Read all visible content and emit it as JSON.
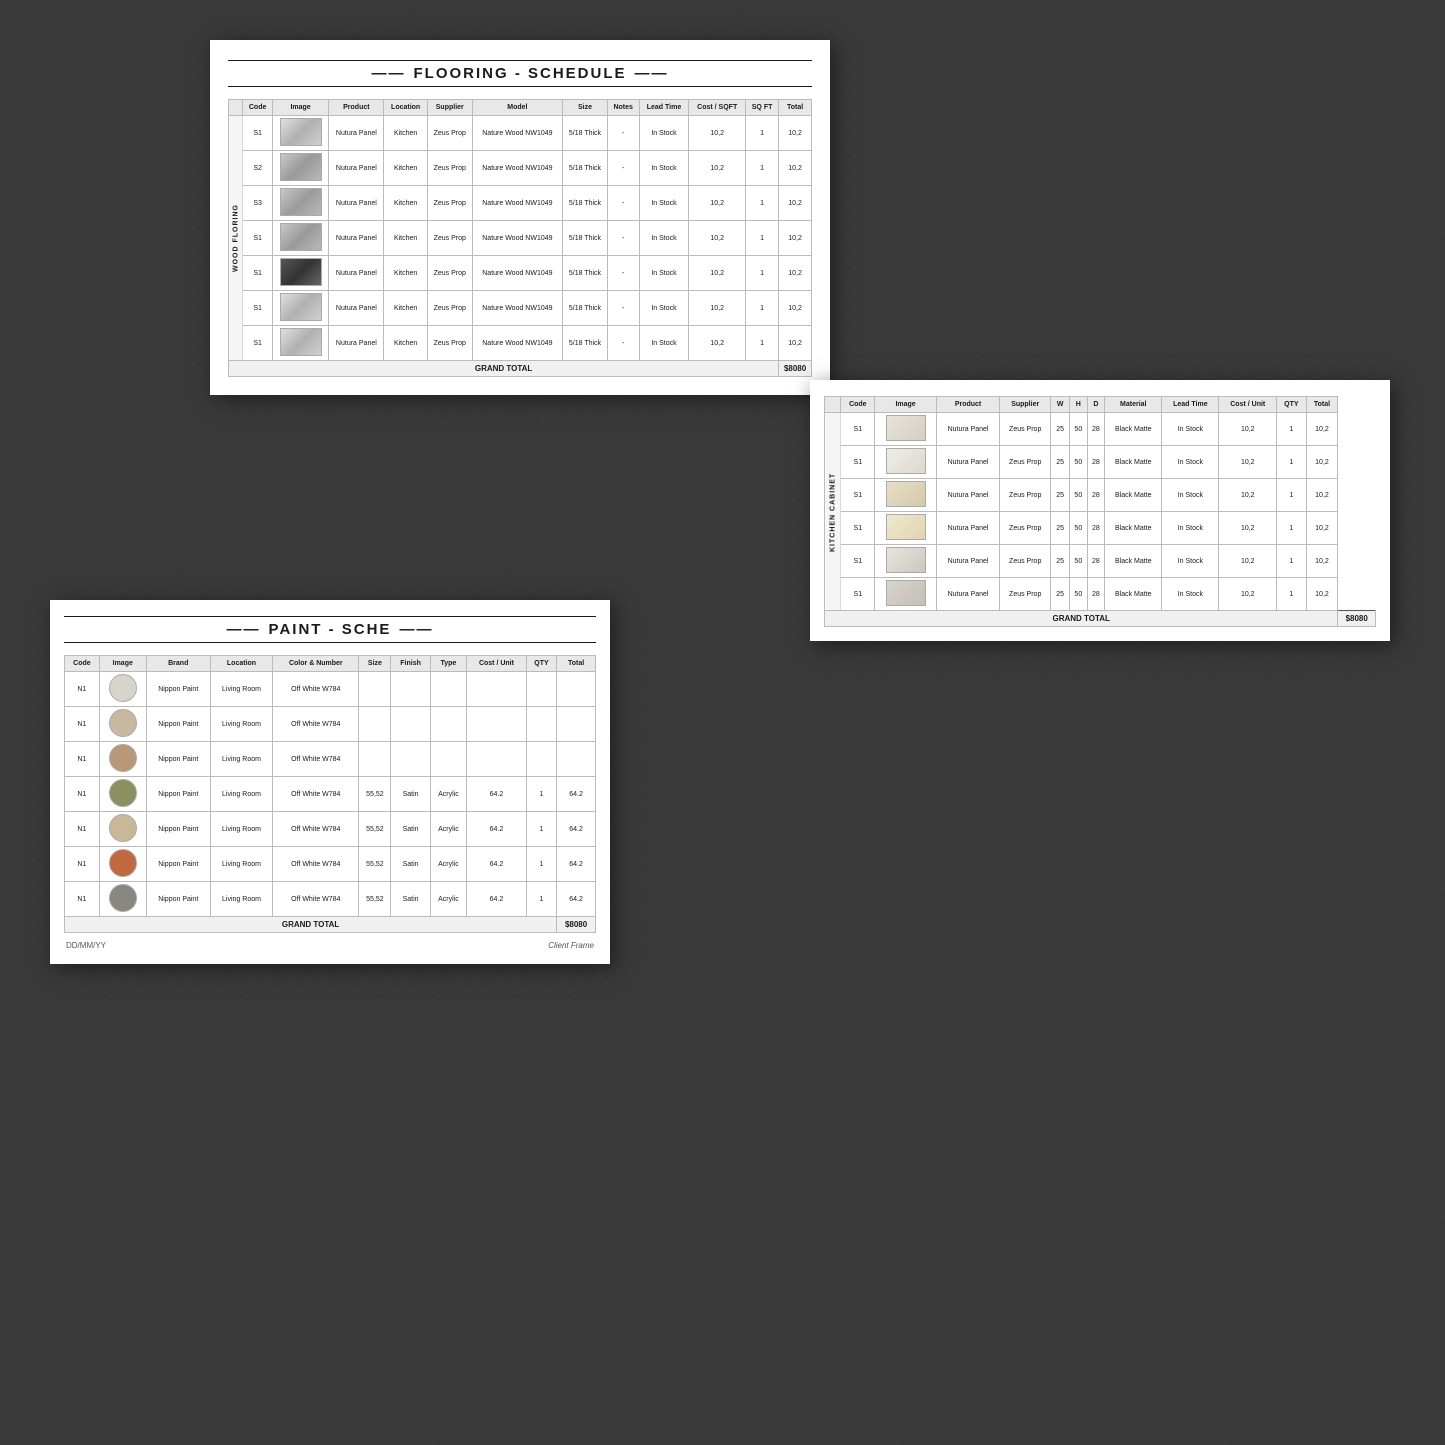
{
  "background": "#3a3a3a",
  "flooring": {
    "title": "FLOORING - SCHEDULE",
    "section_label": "WOOD FLORING",
    "columns": [
      "Code",
      "Image",
      "Product",
      "Location",
      "Supplier",
      "Model",
      "Size",
      "Notes",
      "Lead Time",
      "Cost / SQFT",
      "SQ FT",
      "Total"
    ],
    "rows": [
      {
        "code": "S1",
        "product": "Nutura Panel",
        "location": "Kitchen",
        "supplier": "Zeus Prop",
        "model": "Nature Wood NW1049",
        "size": "5/18 Thick",
        "notes": "-",
        "lead_time": "In Stock",
        "cost_sqft": "10,2",
        "sq_ft": "1",
        "total": "10,2",
        "img": "img-marble"
      },
      {
        "code": "S2",
        "product": "Nutura Panel",
        "location": "Kitchen",
        "supplier": "Zeus Prop",
        "model": "Nature Wood NW1049",
        "size": "5/18 Thick",
        "notes": "-",
        "lead_time": "In Stock",
        "cost_sqft": "10,2",
        "sq_ft": "1",
        "total": "10,2",
        "img": "img-grey"
      },
      {
        "code": "S3",
        "product": "Nutura Panel",
        "location": "Kitchen",
        "supplier": "Zeus Prop",
        "model": "Nature Wood NW1049",
        "size": "5/18 Thick",
        "notes": "-",
        "lead_time": "In Stock",
        "cost_sqft": "10,2",
        "sq_ft": "1",
        "total": "10,2",
        "img": "img-grey"
      },
      {
        "code": "S1",
        "product": "Nutura Panel",
        "location": "Kitchen",
        "supplier": "Zeus Prop",
        "model": "Nature Wood NW1049",
        "size": "5/18 Thick",
        "notes": "-",
        "lead_time": "In Stock",
        "cost_sqft": "10,2",
        "sq_ft": "1",
        "total": "10,2",
        "img": "img-grey"
      },
      {
        "code": "S1",
        "product": "Nutura Panel",
        "location": "Kitchen",
        "supplier": "Zeus Prop",
        "model": "Nature Wood NW1049",
        "size": "5/18 Thick",
        "notes": "-",
        "lead_time": "In Stock",
        "cost_sqft": "10,2",
        "sq_ft": "1",
        "total": "10,2",
        "img": "img-dark"
      },
      {
        "code": "S1",
        "product": "Nutura Panel",
        "location": "Kitchen",
        "supplier": "Zeus Prop",
        "model": "Nature Wood NW1049",
        "size": "5/18 Thick",
        "notes": "-",
        "lead_time": "In Stock",
        "cost_sqft": "10,2",
        "sq_ft": "1",
        "total": "10,2",
        "img": "img-marble"
      },
      {
        "code": "S1",
        "product": "Nutura Panel",
        "location": "Kitchen",
        "supplier": "Zeus Prop",
        "model": "Nature Wood NW1049",
        "size": "5/18 Thick",
        "notes": "-",
        "lead_time": "In Stock",
        "cost_sqft": "10,2",
        "sq_ft": "1",
        "total": "10,2",
        "img": "img-marble"
      }
    ],
    "grand_total_label": "GRAND TOTAL",
    "grand_total_value": "$8080"
  },
  "kitchen": {
    "title": "KITCHEN CABINET",
    "columns": [
      "Code",
      "Image",
      "Product",
      "Supplier",
      "Width",
      "Height",
      "Depth",
      "Material",
      "Lead Time",
      "Cost / Unit",
      "QTY",
      "Total"
    ],
    "rows": [
      {
        "code": "S1",
        "product": "Nutura Panel",
        "supplier": "Zeus Prop",
        "width": "25",
        "height": "50",
        "depth": "28",
        "material": "Black Matte",
        "lead_time": "In Stock",
        "cost_unit": "10,2",
        "qty": "1",
        "total": "10,2",
        "img": "img-cab1"
      },
      {
        "code": "S1",
        "product": "Nutura Panel",
        "supplier": "Zeus Prop",
        "width": "25",
        "height": "50",
        "depth": "28",
        "material": "Black Matte",
        "lead_time": "In Stock",
        "cost_unit": "10,2",
        "qty": "1",
        "total": "10,2",
        "img": "img-cab2"
      },
      {
        "code": "S1",
        "product": "Nutura Panel",
        "supplier": "Zeus Prop",
        "width": "25",
        "height": "50",
        "depth": "28",
        "material": "Black Matte",
        "lead_time": "In Stock",
        "cost_unit": "10,2",
        "qty": "1",
        "total": "10,2",
        "img": "img-cab3"
      },
      {
        "code": "S1",
        "product": "Nutura Panel",
        "supplier": "Zeus Prop",
        "width": "25",
        "height": "50",
        "depth": "28",
        "material": "Black Matte",
        "lead_time": "In Stock",
        "cost_unit": "10,2",
        "qty": "1",
        "total": "10,2",
        "img": "img-cab4"
      },
      {
        "code": "S1",
        "product": "Nutura Panel",
        "supplier": "Zeus Prop",
        "width": "25",
        "height": "50",
        "depth": "28",
        "material": "Black Matte",
        "lead_time": "In Stock",
        "cost_unit": "10,2",
        "qty": "1",
        "total": "10,2",
        "img": "img-cab5"
      },
      {
        "code": "S1",
        "product": "Nutura Panel",
        "supplier": "Zeus Prop",
        "width": "25",
        "height": "50",
        "depth": "28",
        "material": "Black Matte",
        "lead_time": "In Stock",
        "cost_unit": "10,2",
        "qty": "1",
        "total": "10,2",
        "img": "img-cab6"
      }
    ],
    "grand_total_label": "GRAND TOTAL",
    "grand_total_value": "$8080"
  },
  "paint": {
    "title": "PAINT - SCHE",
    "columns": [
      "Code",
      "Image",
      "Brand",
      "Location",
      "Color & Number",
      "Size",
      "Finish",
      "Type",
      "Cost / Unit",
      "QTY",
      "Total"
    ],
    "rows": [
      {
        "code": "N1",
        "brand": "Nippon Paint",
        "location": "Living Room",
        "color": "Off White W784",
        "size": "",
        "finish": "",
        "type": "",
        "cost": "",
        "qty": "",
        "total": "",
        "swatch_color": "#d8d4cc"
      },
      {
        "code": "N1",
        "brand": "Nippon Paint",
        "location": "Living Room",
        "color": "Off White W784",
        "size": "",
        "finish": "",
        "type": "",
        "cost": "",
        "qty": "",
        "total": "",
        "swatch_color": "#c8b8a0"
      },
      {
        "code": "N1",
        "brand": "Nippon Paint",
        "location": "Living Room",
        "color": "Off White W784",
        "size": "",
        "finish": "",
        "type": "",
        "cost": "",
        "qty": "",
        "total": "",
        "swatch_color": "#b89878"
      },
      {
        "code": "N1",
        "brand": "Nippon Paint",
        "location": "Living Room",
        "color": "Off White W784",
        "size": "55,52",
        "finish": "Satin",
        "type": "Acrylic",
        "cost": "64.2",
        "qty": "1",
        "total": "64.2",
        "swatch_color": "#8a9060"
      },
      {
        "code": "N1",
        "brand": "Nippon Paint",
        "location": "Living Room",
        "color": "Off White W784",
        "size": "55,52",
        "finish": "Satin",
        "type": "Acrylic",
        "cost": "64.2",
        "qty": "1",
        "total": "64.2",
        "swatch_color": "#c8b898"
      },
      {
        "code": "N1",
        "brand": "Nippon Paint",
        "location": "Living Room",
        "color": "Off White W784",
        "size": "55,52",
        "finish": "Satin",
        "type": "Acrylic",
        "cost": "64.2",
        "qty": "1",
        "total": "64.2",
        "swatch_color": "#c06840"
      },
      {
        "code": "N1",
        "brand": "Nippon Paint",
        "location": "Living Room",
        "color": "Off White W784",
        "size": "55,52",
        "finish": "Satin",
        "type": "Acrylic",
        "cost": "64.2",
        "qty": "1",
        "total": "64.2",
        "swatch_color": "#888880"
      }
    ],
    "grand_total_label": "GRAND TOTAL",
    "grand_total_value": "$8080",
    "footer_date": "DD/MM/YY",
    "footer_client": "Client Frame"
  }
}
